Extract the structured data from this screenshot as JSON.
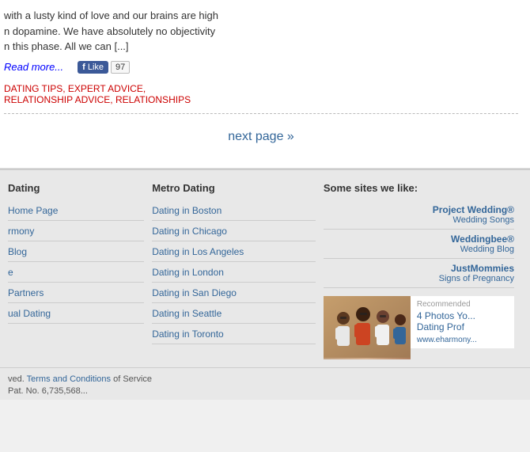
{
  "article": {
    "text_line1": "with a lusty kind of love and our brains are high",
    "text_line2": "n dopamine. We have absolutely no objectivity",
    "text_line3": "n this phase. All we can [...]",
    "read_more": "Read more...",
    "fb_like_label": "Like",
    "fb_like_icon": "f",
    "fb_count": "97"
  },
  "tags": [
    {
      "label": "DATING TIPS",
      "href": "#"
    },
    {
      "label": "EXPERT ADVICE",
      "href": "#"
    },
    {
      "label": "RELATIONSHIP ADVICE",
      "href": "#"
    },
    {
      "label": "RELATIONSHIPS",
      "href": "#"
    }
  ],
  "pagination": {
    "next_label": "next page »"
  },
  "footer": {
    "col_dating": {
      "title": "Dating",
      "items": [
        {
          "label": "Home Page",
          "href": "#"
        },
        {
          "label": "rmony",
          "href": "#"
        },
        {
          "label": "Blog",
          "href": "#"
        },
        {
          "label": "e",
          "href": "#"
        },
        {
          "label": "Partners",
          "href": "#"
        },
        {
          "label": "ual Dating",
          "href": "#"
        }
      ]
    },
    "col_metro": {
      "title": "Metro Dating",
      "items": [
        {
          "label": "Dating in Boston",
          "href": "#"
        },
        {
          "label": "Dating in Chicago",
          "href": "#"
        },
        {
          "label": "Dating in Los Angeles",
          "href": "#"
        },
        {
          "label": "Dating in London",
          "href": "#"
        },
        {
          "label": "Dating in San Diego",
          "href": "#"
        },
        {
          "label": "Dating in Seattle",
          "href": "#"
        },
        {
          "label": "Dating in Toronto",
          "href": "#"
        }
      ]
    },
    "col_sites": {
      "title": "Some sites we like:",
      "items": [
        {
          "name": "Project Wedding®",
          "sub": "Wedding Songs"
        },
        {
          "name": "Weddingbee®",
          "sub": "Wedding Blog"
        },
        {
          "name": "JustMommies",
          "sub": "Signs of Pregnancy"
        }
      ]
    },
    "ad": {
      "recommended_label": "Recommended",
      "title": "4 Photos Yo...\nDating Prof",
      "url": "www.eharmony...",
      "emoji": "👫👫"
    },
    "bottom": {
      "reserved_text": "ved.",
      "terms_label": "Terms and Conditions",
      "service_text": "of Service",
      "patent_text": "Pat. No. 6,735,568..."
    }
  }
}
